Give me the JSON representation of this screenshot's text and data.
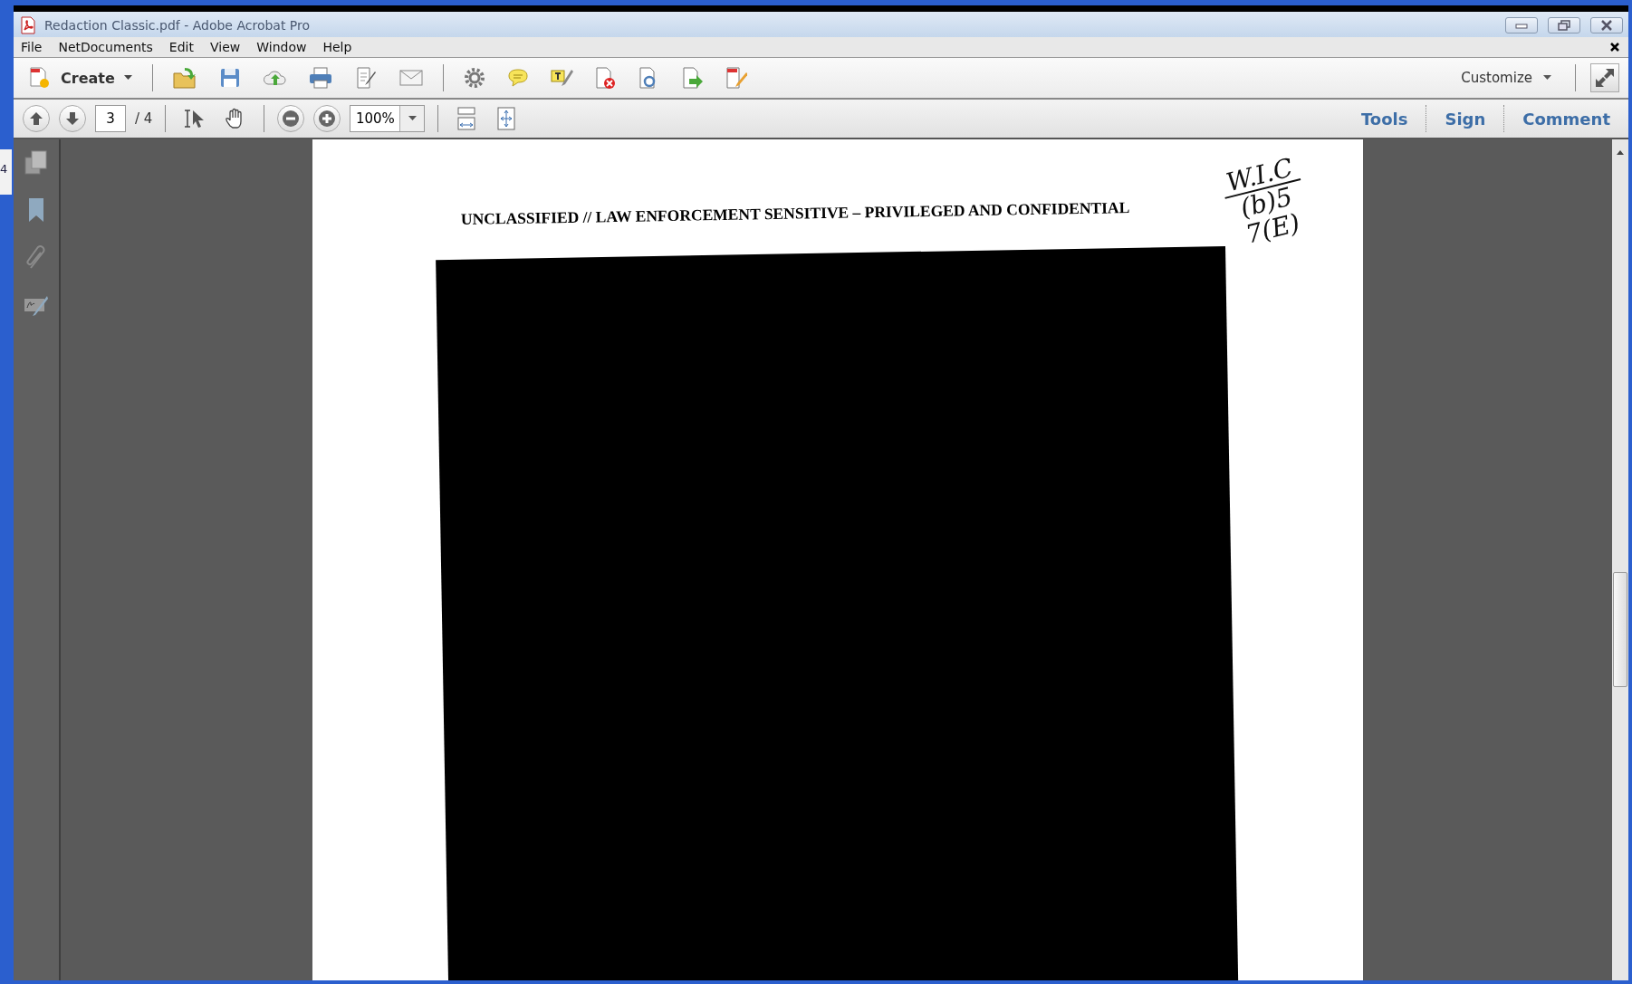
{
  "window": {
    "title": "Redaction Classic.pdf - Adobe Acrobat Pro"
  },
  "menu": [
    "File",
    "NetDocuments",
    "Edit",
    "View",
    "Window",
    "Help"
  ],
  "toolbar": {
    "create_label": "Create",
    "customize_label": "Customize"
  },
  "navigation": {
    "page": "3",
    "page_total": "/ 4",
    "zoom": "100%"
  },
  "task_tabs": [
    {
      "label": "Tools"
    },
    {
      "label": "Sign"
    },
    {
      "label": "Comment"
    }
  ],
  "document": {
    "header": "UNCLASSIFIED // LAW ENFORCEMENT SENSITIVE – PRIVILEGED AND CONFIDENTIAL",
    "handwritten_note": [
      "W.I.C",
      "(b)5",
      "7(E)"
    ]
  },
  "background_window": {
    "fragment": "4"
  }
}
